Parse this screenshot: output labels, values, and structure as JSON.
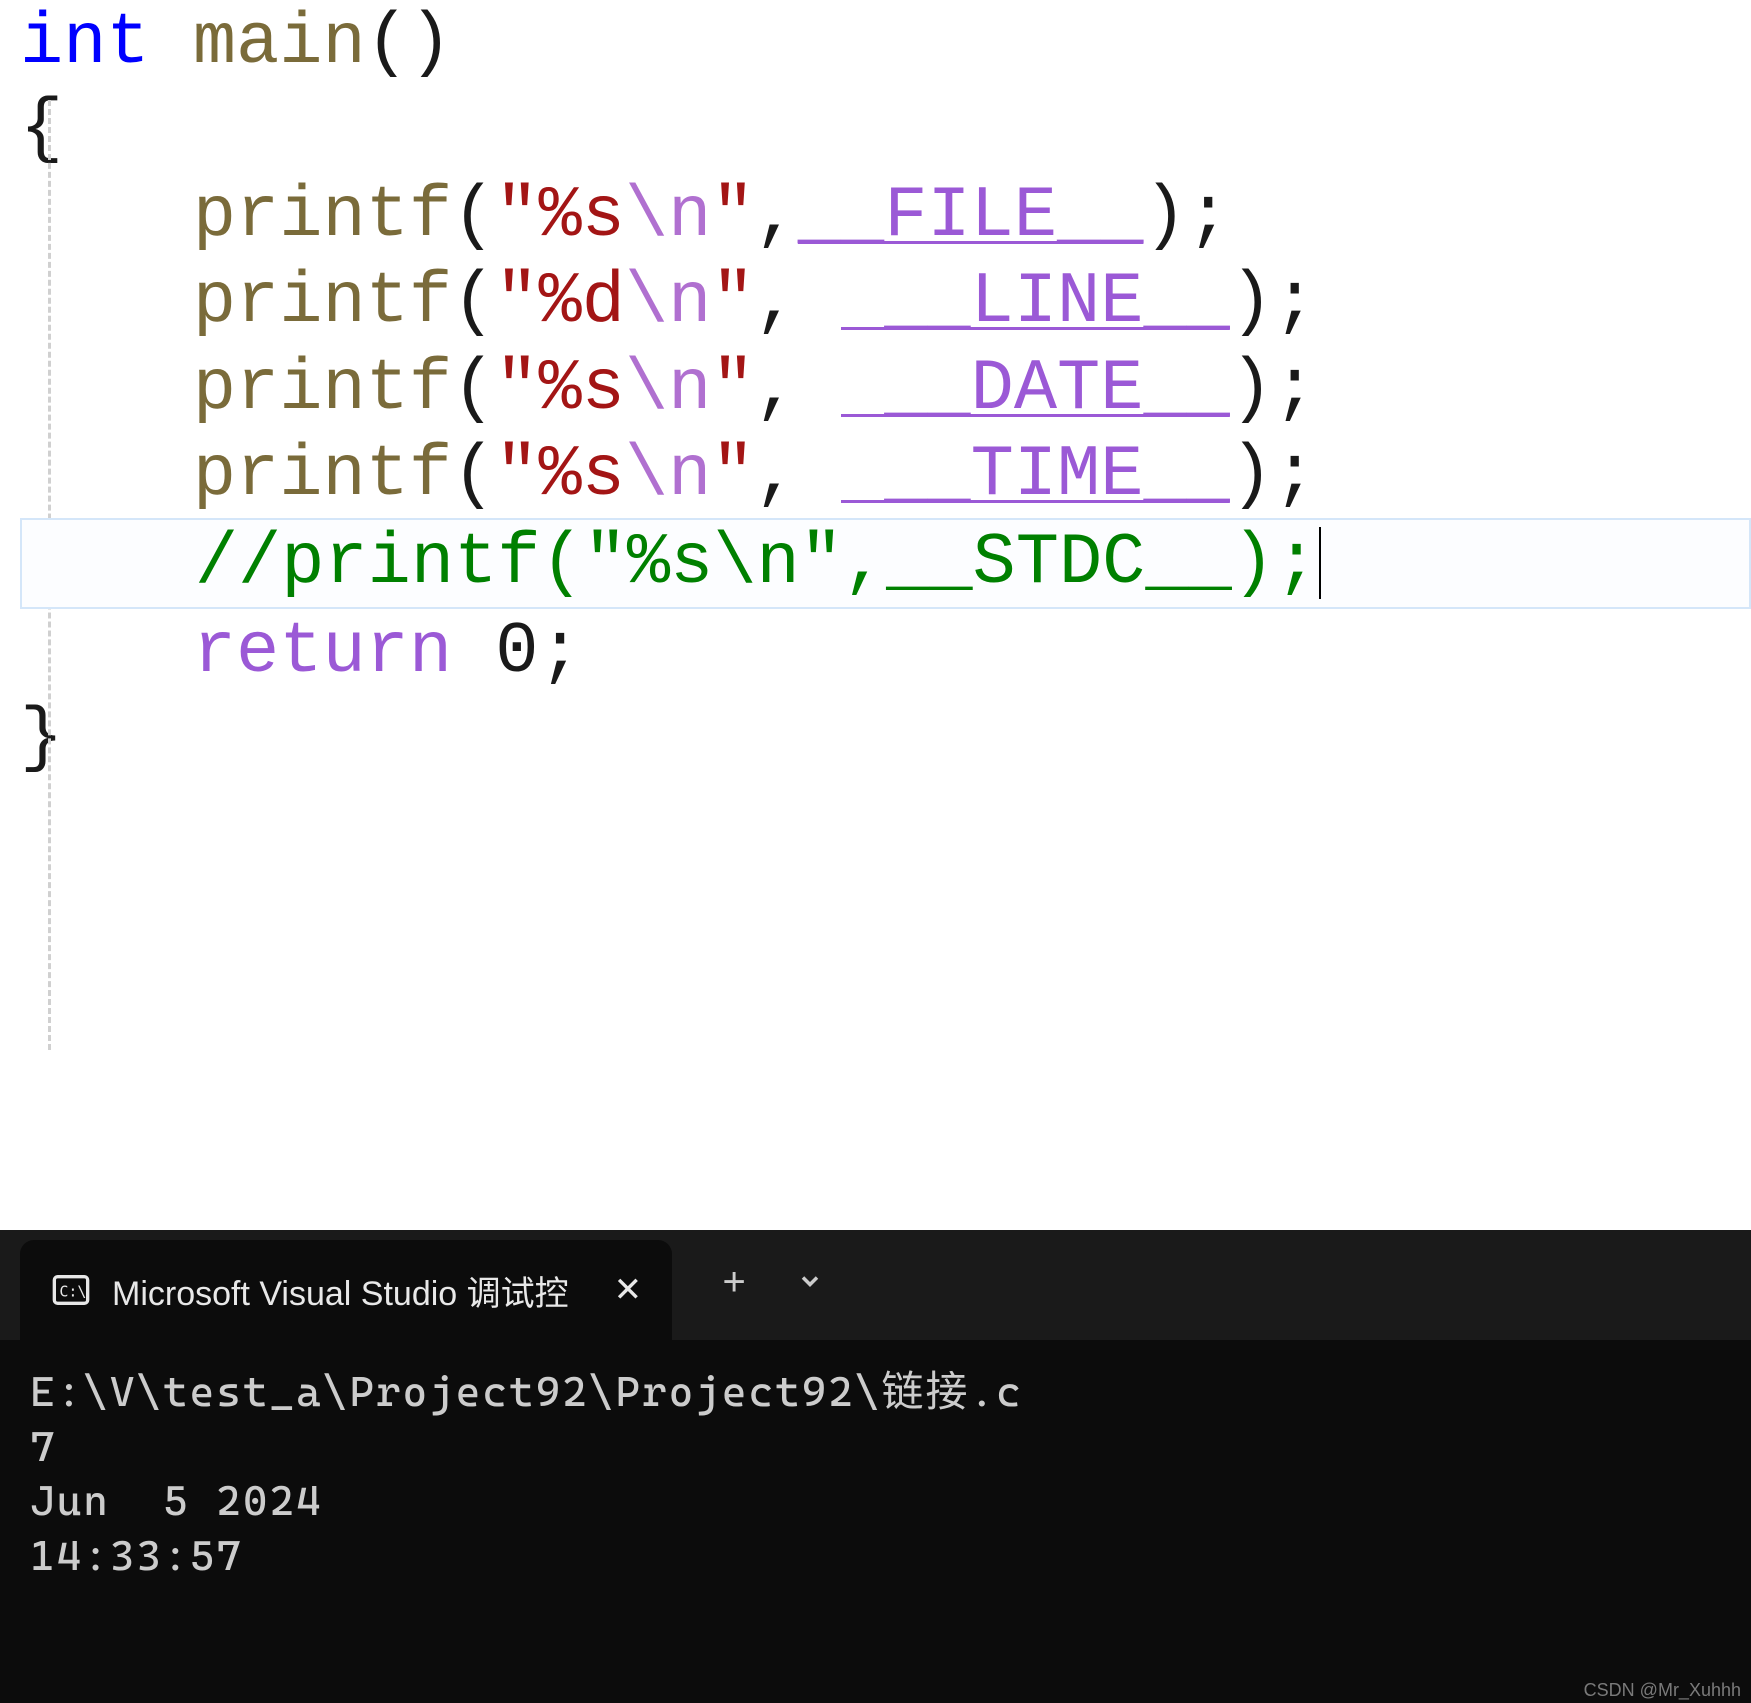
{
  "code": {
    "l1": {
      "type": "int",
      "sp": " ",
      "fn": "main",
      "p": "()"
    },
    "l2": {
      "brace": "{"
    },
    "l3": {
      "indent": "    ",
      "call": "printf",
      "op": "(",
      "q1": "\"",
      "fmt": "%s",
      "esc": "\\n",
      "q2": "\"",
      "comma": ",",
      "macro": "__FILE__",
      "cp": ")",
      "semi": ";"
    },
    "l4": {
      "indent": "    ",
      "call": "printf",
      "op": "(",
      "q1": "\"",
      "fmt": "%d",
      "esc": "\\n",
      "q2": "\"",
      "comma": ", ",
      "macro": " __LINE__",
      "cp": ")",
      "semi": ";"
    },
    "l5": {
      "indent": "    ",
      "call": "printf",
      "op": "(",
      "q1": "\"",
      "fmt": "%s",
      "esc": "\\n",
      "q2": "\"",
      "comma": ", ",
      "macro": " __DATE__",
      "cp": ")",
      "semi": ";"
    },
    "l6": {
      "indent": "    ",
      "call": "printf",
      "op": "(",
      "q1": "\"",
      "fmt": "%s",
      "esc": "\\n",
      "q2": "\"",
      "comma": ", ",
      "macro": " __TIME__",
      "cp": ")",
      "semi": ";"
    },
    "l7": {
      "indent": "    ",
      "comment": "//printf(\"%s\\n\",__STDC__);"
    },
    "l8": {
      "indent": "    ",
      "ret": "return",
      "sp": " ",
      "num": "0",
      "semi": ";"
    },
    "l9": {
      "brace": "}"
    }
  },
  "terminal": {
    "tab_title": "Microsoft Visual Studio 调试控",
    "output": {
      "line1": "E:\\V\\test_a\\Project92\\Project92\\链接.c",
      "line2": "7",
      "line3": "Jun  5 2024",
      "line4": "14:33:57"
    }
  },
  "watermark": "CSDN @Mr_Xuhhh"
}
